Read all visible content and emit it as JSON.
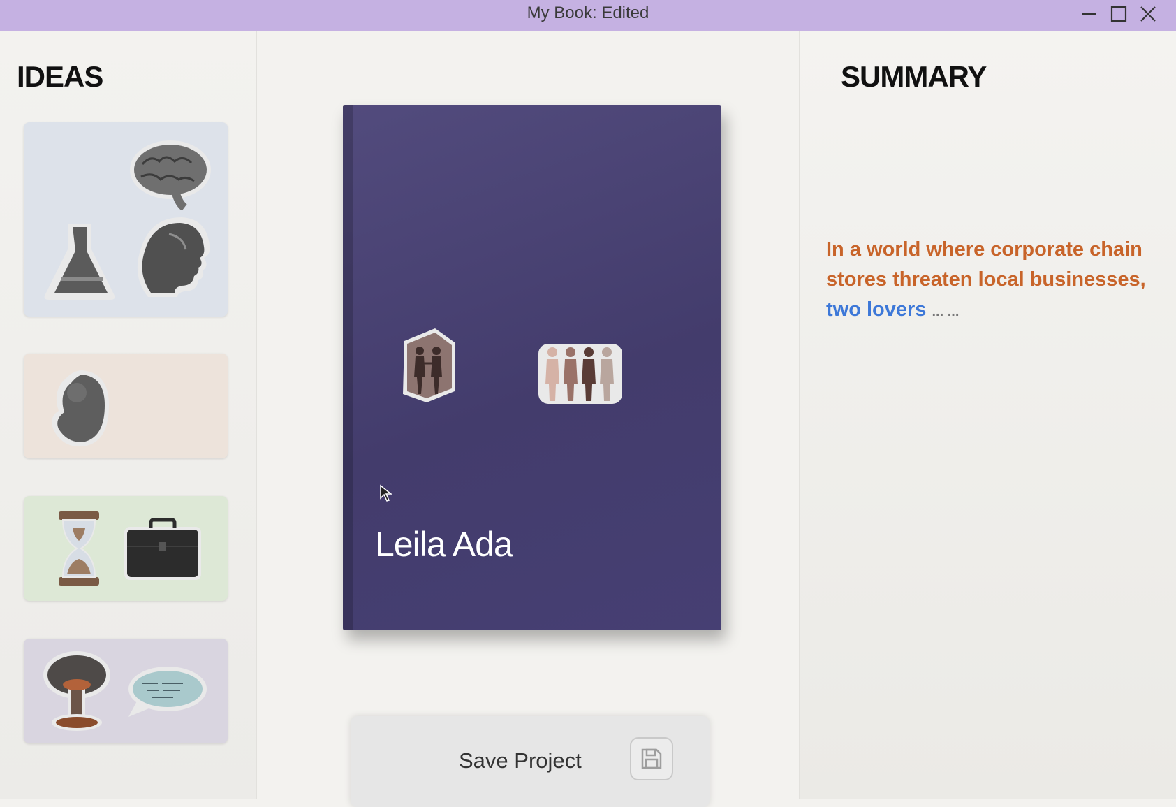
{
  "window": {
    "title": "My Book: Edited"
  },
  "ideas": {
    "heading": "IDEAS",
    "cards": [
      {
        "icons": [
          "brain-icon",
          "flask-icon",
          "face-profile-icon"
        ],
        "bg": "#dde2ea"
      },
      {
        "icons": [
          "fetus-icon"
        ],
        "bg": "#ede3db"
      },
      {
        "icons": [
          "hourglass-icon",
          "briefcase-icon"
        ],
        "bg": "#dde8d6"
      },
      {
        "icons": [
          "mushroom-cloud-icon",
          "speech-bubble-icon"
        ],
        "bg": "#d9d5e0"
      }
    ]
  },
  "book": {
    "author": "Leila Ada",
    "icons": [
      "couple-holding-hands-icon",
      "group-of-people-icon"
    ],
    "color": "#4a4376"
  },
  "save": {
    "label": "Save Project",
    "icon": "floppy-disk-icon"
  },
  "summary": {
    "heading": "SUMMARY",
    "text_orange": "In a world where corporate chain stores threaten local businesses,",
    "text_blue": "two lovers",
    "text_ellipsis": "... ...",
    "colors": {
      "orange": "#c8642a",
      "blue": "#3d78d8",
      "ellipsis": "#777777"
    }
  }
}
